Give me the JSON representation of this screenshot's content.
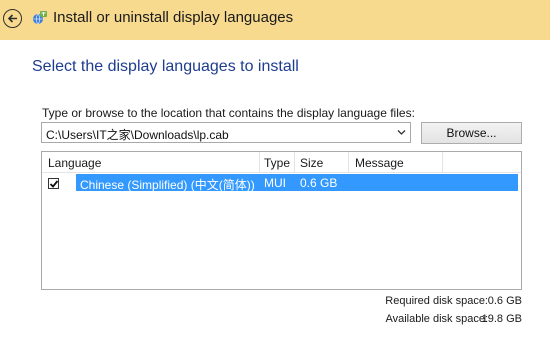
{
  "window": {
    "title": "Install or uninstall display languages"
  },
  "page": {
    "heading": "Select the display languages to install"
  },
  "location": {
    "label": "Type or browse to the location that contains the display language files:",
    "value": "C:\\Users\\IT之家\\Downloads\\lp.cab",
    "browse_label": "Browse..."
  },
  "list": {
    "columns": [
      "Language",
      "Type",
      "Size",
      "Message"
    ],
    "rows": [
      {
        "checked": true,
        "language": "Chinese (Simplified) (中文(简体))",
        "type": "MUI",
        "size": "0.6 GB",
        "message": ""
      }
    ]
  },
  "disk": {
    "required_label": "Required disk space:",
    "required_value": "0.6 GB",
    "available_label": "Available disk space:",
    "available_value": "19.8 GB"
  },
  "colors": {
    "titlebar": "#f7da8e",
    "heading": "#1e3d8f",
    "selection": "#3399ff"
  },
  "icons": [
    "back-arrow-icon",
    "language-globe-icon",
    "chevron-down-icon",
    "checkmark-icon"
  ]
}
